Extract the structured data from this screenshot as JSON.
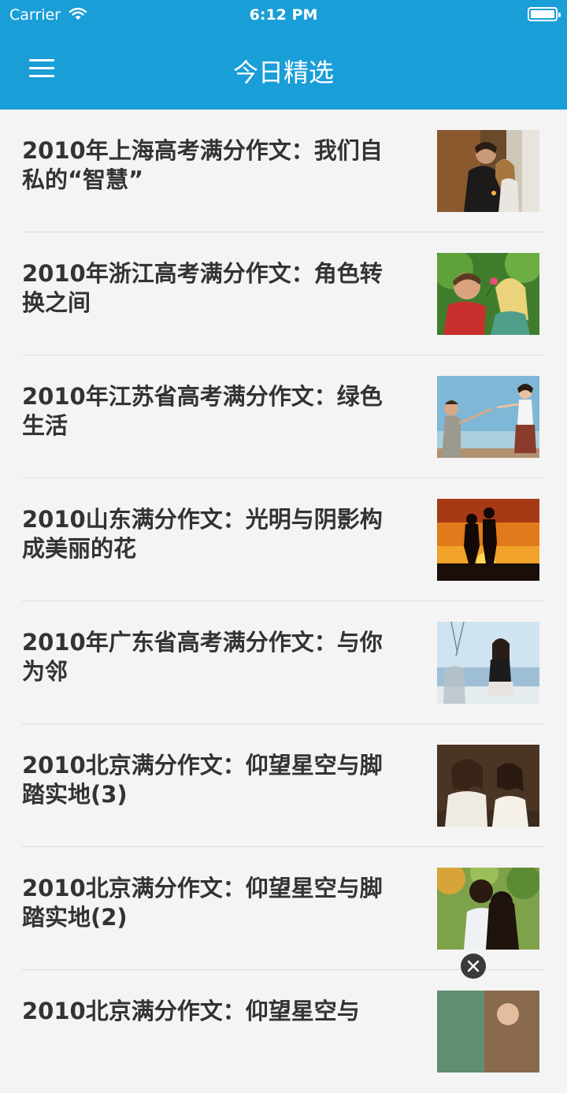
{
  "status_bar": {
    "carrier": "Carrier",
    "time": "6:12 PM",
    "wifi_icon": "wifi-icon",
    "battery_icon": "battery-icon"
  },
  "nav": {
    "title": "今日精选",
    "menu_icon": "menu-icon",
    "color": "#1a9ed8"
  },
  "articles": [
    {
      "title": "2010年上海高考满分作文：我们自私的“智慧”",
      "thumbnail": "couple-indoor-photo"
    },
    {
      "title": "2010年浙江高考满分作文：角色转换之间",
      "thumbnail": "couple-flower-photo"
    },
    {
      "title": "2010年江苏省高考满分作文：绿色生活",
      "thumbnail": "couple-sky-photo"
    },
    {
      "title": "2010山东满分作文：光明与阴影构成美丽的花",
      "thumbnail": "couple-sunset-silhouette-photo"
    },
    {
      "title": "2010年广东省高考满分作文：与你为邻",
      "thumbnail": "girl-seaside-photo"
    },
    {
      "title": "2010北京满分作文：仰望星空与脚踏实地(3)",
      "thumbnail": "couple-laughing-photo"
    },
    {
      "title": "2010北京满分作文：仰望星空与脚踏实地(2)",
      "thumbnail": "couple-garden-photo"
    },
    {
      "title": "2010北京满分作文：仰望星空与",
      "thumbnail": "couple-photo"
    }
  ],
  "ad_close_icon": "close-icon"
}
